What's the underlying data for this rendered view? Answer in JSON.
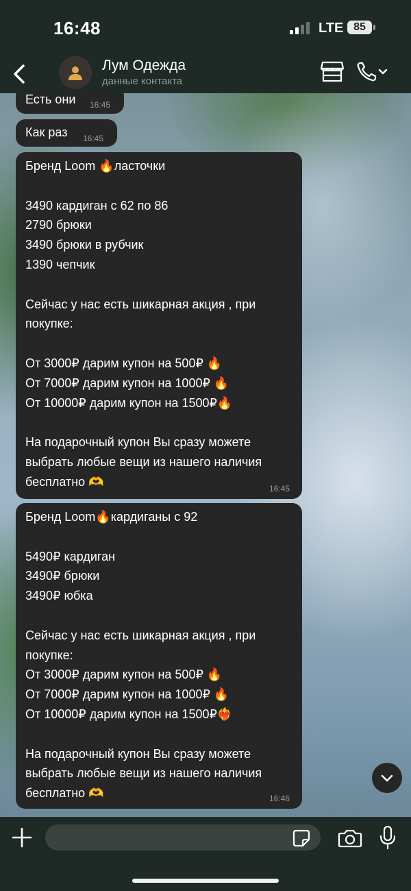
{
  "status": {
    "time": "16:48",
    "network": "LTE",
    "battery": "85",
    "signal_bars_active": 2,
    "signal_bars_total": 4
  },
  "header": {
    "name": "Лум Одежда",
    "subtitle": "данные контакта",
    "back_icon": "chevron-left-icon",
    "shop_icon": "storefront-icon",
    "call_icon": "phone-icon"
  },
  "messages": [
    {
      "text": "Есть они",
      "time": "16:45"
    },
    {
      "text": "Как раз",
      "time": "16:45"
    },
    {
      "text": "Бренд Loom 🔥ласточки\n\n3490 кардиган с 62 по 86\n2790 брюки\n3490 брюки в рубчик\n1390 чепчик\n\nСейчас у нас есть шикарная акция , при покупке:\n\nОт 3000₽ дарим купон на 500₽ 🔥\nОт 7000₽ дарим купон на 1000₽ 🔥\nОт 10000₽ дарим купон на 1500₽🔥\n\nНа подарочный купон Вы сразу можете выбрать любые вещи из нашего наличия бесплатно 🫶",
      "time": "16:45"
    },
    {
      "text": "Бренд Loom🔥кардиганы с 92\n\n5490₽ кардиган\n3490₽ брюки\n3490₽ юбка\n\nСейчас у нас есть шикарная акция , при покупке:\nОт 3000₽ дарим купон на 500₽ 🔥\nОт 7000₽ дарим купон на 1000₽ 🔥\nОт 10000₽ дарим купон на 1500₽❤️‍🔥\n\nНа подарочный купон Вы сразу можете выбрать любые вещи из нашего наличия бесплатно 🫶",
      "time": "16:46"
    }
  ],
  "composer": {
    "placeholder": "",
    "value": ""
  },
  "colors": {
    "bar_bg": "#1f2a27",
    "bubble_bg": "#262626",
    "muted_text": "#8e9995"
  }
}
